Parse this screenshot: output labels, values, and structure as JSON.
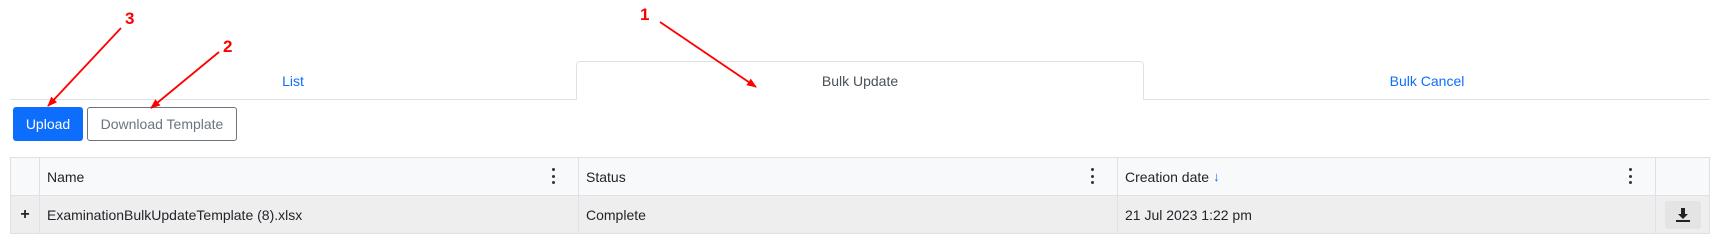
{
  "tabs": [
    {
      "label": "List",
      "active": false
    },
    {
      "label": "Bulk Update",
      "active": true
    },
    {
      "label": "Bulk Cancel",
      "active": false
    }
  ],
  "toolbar": {
    "upload_label": "Upload",
    "download_template_label": "Download Template"
  },
  "grid": {
    "columns": [
      "Name",
      "Status",
      "Creation date"
    ],
    "sort_indicator": "↓",
    "rows": [
      {
        "expand": "+",
        "name": "ExaminationBulkUpdateTemplate (8).xlsx",
        "status": "Complete",
        "creation_date": "21 Jul 2023 1:22 pm"
      }
    ]
  },
  "annotations": [
    "1",
    "2",
    "3"
  ],
  "colors": {
    "accent": "#0d6efd",
    "annotation": "#ff0000"
  }
}
